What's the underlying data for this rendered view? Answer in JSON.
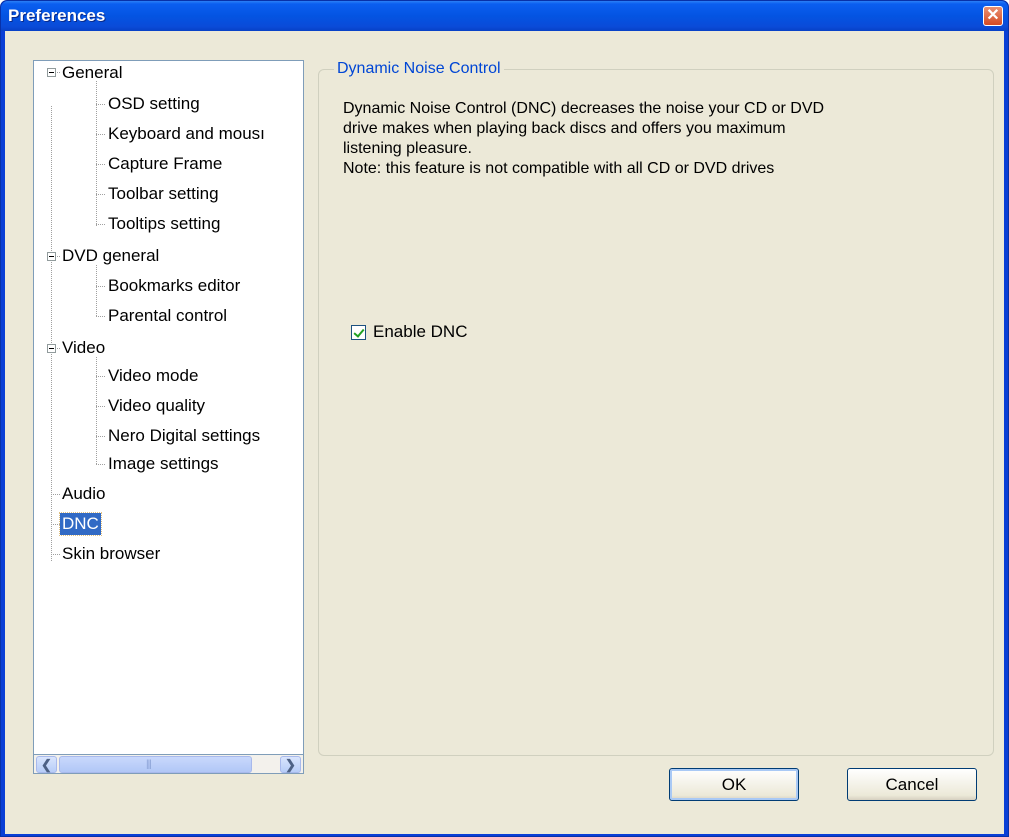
{
  "window": {
    "title": "Preferences"
  },
  "tree": {
    "nodes": [
      {
        "label": "General"
      },
      {
        "label": "OSD setting"
      },
      {
        "label": "Keyboard and mousı"
      },
      {
        "label": "Capture Frame"
      },
      {
        "label": "Toolbar setting"
      },
      {
        "label": "Tooltips setting"
      },
      {
        "label": "DVD general"
      },
      {
        "label": "Bookmarks editor"
      },
      {
        "label": "Parental control"
      },
      {
        "label": "Video"
      },
      {
        "label": "Video mode"
      },
      {
        "label": "Video quality"
      },
      {
        "label": "Nero Digital settings"
      },
      {
        "label": "Image settings"
      },
      {
        "label": "Audio"
      },
      {
        "label": "DNC"
      },
      {
        "label": "Skin browser"
      }
    ]
  },
  "panel": {
    "group_title": "Dynamic Noise Control",
    "description_lines": [
      "Dynamic Noise Control (DNC) decreases the noise your CD or DVD",
      "drive makes when playing back discs and offers you maximum",
      "listening pleasure.",
      "Note: this feature is not compatible with all CD or DVD drives"
    ],
    "checkbox_label": "Enable DNC",
    "checkbox_checked": true
  },
  "buttons": {
    "ok": "OK",
    "cancel": "Cancel"
  }
}
